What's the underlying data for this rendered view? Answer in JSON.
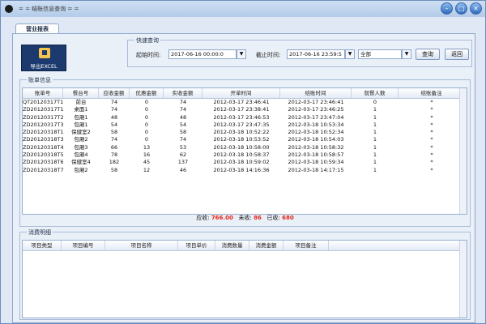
{
  "window": {
    "title": "= = 结账信息查询 = =",
    "controls": [
      "–",
      "□",
      "✕"
    ]
  },
  "tab": {
    "label": "营业报表"
  },
  "toolbar": {
    "export_label": "导出EXCEL",
    "export_icon": "excel-icon"
  },
  "quick_query": {
    "group_title": "快速查询",
    "start_label": "起始时间:",
    "start_value": "2017-06-16 00:00:0",
    "end_label": "截止时间:",
    "end_value": "2017-06-16 23:59:5",
    "filter_value": "全部",
    "query_button": "查询",
    "back_button": "返回"
  },
  "bill_panel": {
    "title": "账单信息",
    "columns": [
      "账单号",
      "餐台号",
      "应收金额",
      "优惠金额",
      "实收金额",
      "开单时间",
      "结账时间",
      "就餐人数",
      "结账备注"
    ],
    "rows": [
      [
        "QT20120317T1",
        "前台",
        "74",
        "0",
        "74",
        "2012-03-17 23:46:41",
        "2012-03-17 23:46:41",
        "0",
        "*"
      ],
      [
        "ZD20120317T1",
        "桌面1",
        "74",
        "0",
        "74",
        "2012-03-17 23:38:41",
        "2012-03-17 23:46:25",
        "1",
        "*"
      ],
      [
        "ZD20120317T2",
        "包厢1",
        "48",
        "0",
        "48",
        "2012-03-17 23:46:53",
        "2012-03-17 23:47:04",
        "1",
        "*"
      ],
      [
        "ZD20120317T3",
        "包厢1",
        "54",
        "0",
        "54",
        "2012-03-17 23:47:35",
        "2012-03-18 10:53:34",
        "1",
        "*"
      ],
      [
        "ZD20120318T1",
        "保健室2",
        "58",
        "0",
        "58",
        "2012-03-18 10:52:22",
        "2012-03-18 10:52:34",
        "1",
        "*"
      ],
      [
        "ZD20120318T3",
        "包厢2",
        "74",
        "0",
        "74",
        "2012-03-18 10:53:52",
        "2012-03-18 10:54:03",
        "1",
        "*"
      ],
      [
        "ZD20120318T4",
        "包厢3",
        "66",
        "13",
        "53",
        "2012-03-18 10:58:00",
        "2012-03-18 10:58:32",
        "1",
        "*"
      ],
      [
        "ZD20120318T5",
        "包厢4",
        "78",
        "16",
        "62",
        "2012-03-18 10:58:37",
        "2012-03-18 10:58:57",
        "1",
        "*"
      ],
      [
        "ZD20120318T6",
        "保健室4",
        "182",
        "45",
        "137",
        "2012-03-18 10:59:02",
        "2012-03-18 10:59:34",
        "1",
        "*"
      ],
      [
        "ZD20120318T7",
        "包厢2",
        "58",
        "12",
        "46",
        "2012-03-18 14:16:36",
        "2012-03-18 14:17:15",
        "1",
        "*"
      ]
    ],
    "summary": {
      "receivable_label": "应收:",
      "receivable": "766.00",
      "unpaid_label": "未收:",
      "unpaid": "86",
      "received_label": "已收:",
      "received": "680"
    }
  },
  "consume_panel": {
    "title": "消费明细",
    "columns": [
      "项目类型",
      "项目编号",
      "项目名称",
      "项目单价",
      "消费数量",
      "消费金额",
      "项目备注"
    ]
  }
}
